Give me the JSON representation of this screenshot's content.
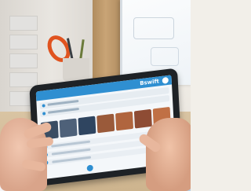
{
  "app": {
    "brand_text": "Bswift"
  },
  "colors": {
    "accent": "#2f8fd1",
    "tablet_bezel": "#1e2226",
    "screen_bg": "#f4f7fa"
  },
  "screen": {
    "thumbnail_colors": [
      "#3a4d63",
      "#4e6179",
      "#2f4560",
      "#9a5a3a",
      "#b0653e",
      "#8e4c34",
      "#c07045"
    ]
  }
}
